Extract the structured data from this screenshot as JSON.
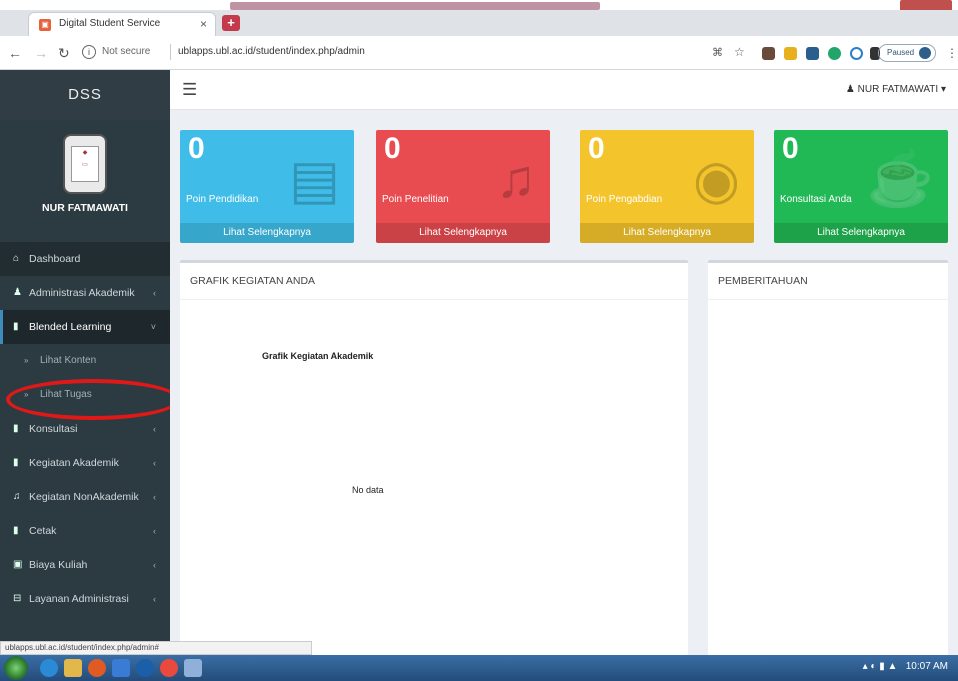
{
  "browser": {
    "tab_title": "Digital Student Service",
    "tab_close": "×",
    "new_tab": "+",
    "not_secure": "Not secure",
    "url": "ublapps.ubl.ac.id/student/index.php/admin",
    "paused_label": "Paused",
    "status_url": "ublapps.ubl.ac.id/student/index.php/admin#"
  },
  "app": {
    "brand": "DSS",
    "user_name": "NUR FATMAWATI",
    "navbar_user": "NUR FATMAWATI ▾"
  },
  "sidebar": {
    "items": [
      {
        "label": "Dashboard",
        "icon": "dashboard-icon",
        "glyph": "⌂"
      },
      {
        "label": "Administrasi Akademik",
        "icon": "user-icon",
        "glyph": "♟",
        "chev": "‹"
      },
      {
        "label": "Blended Learning",
        "icon": "book-icon",
        "glyph": "▮",
        "chev": "˅"
      },
      {
        "label": "Konsultasi",
        "icon": "edit-icon",
        "glyph": "▮",
        "chev": "‹"
      },
      {
        "label": "Kegiatan Akademik",
        "icon": "book-icon",
        "glyph": "▮",
        "chev": "‹"
      },
      {
        "label": "Kegiatan NonAkademik",
        "icon": "music-icon",
        "glyph": "♫",
        "chev": "‹"
      },
      {
        "label": "Cetak",
        "icon": "file-icon",
        "glyph": "▮",
        "chev": "‹"
      },
      {
        "label": "Biaya Kuliah",
        "icon": "money-icon",
        "glyph": "▣",
        "chev": "‹"
      },
      {
        "label": "Layanan Administrasi",
        "icon": "bus-icon",
        "glyph": "⊟",
        "chev": "‹"
      }
    ],
    "sub_items": [
      {
        "label": "Lihat Konten"
      },
      {
        "label": "Lihat Tugas"
      }
    ]
  },
  "info_boxes": [
    {
      "value": "0",
      "label": "Poin Pendidikan",
      "footer": "Lihat Selengkapnya",
      "color": "#3fbde8",
      "icon": "book-icon",
      "glyph": "▤"
    },
    {
      "value": "0",
      "label": "Poin Penelitian",
      "footer": "Lihat Selengkapnya",
      "color": "#e84c50",
      "icon": "music-icon",
      "glyph": "♫"
    },
    {
      "value": "0",
      "label": "Poin Pengabdian",
      "footer": "Lihat Selengkapnya",
      "color": "#f4c42d",
      "icon": "camera-icon",
      "glyph": "◉"
    },
    {
      "value": "0",
      "label": "Konsultasi Anda",
      "footer": "Lihat Selengkapnya",
      "color": "#21b955",
      "icon": "coffee-icon",
      "glyph": "☕"
    }
  ],
  "panels": {
    "chart_panel_title": "GRAFIK KEGIATAN ANDA",
    "chart_title": "Grafik Kegiatan Akademik",
    "no_data": "No data",
    "news_panel_title": "PEMBERITAHUAN"
  },
  "taskbar": {
    "time": "10:07 AM"
  }
}
